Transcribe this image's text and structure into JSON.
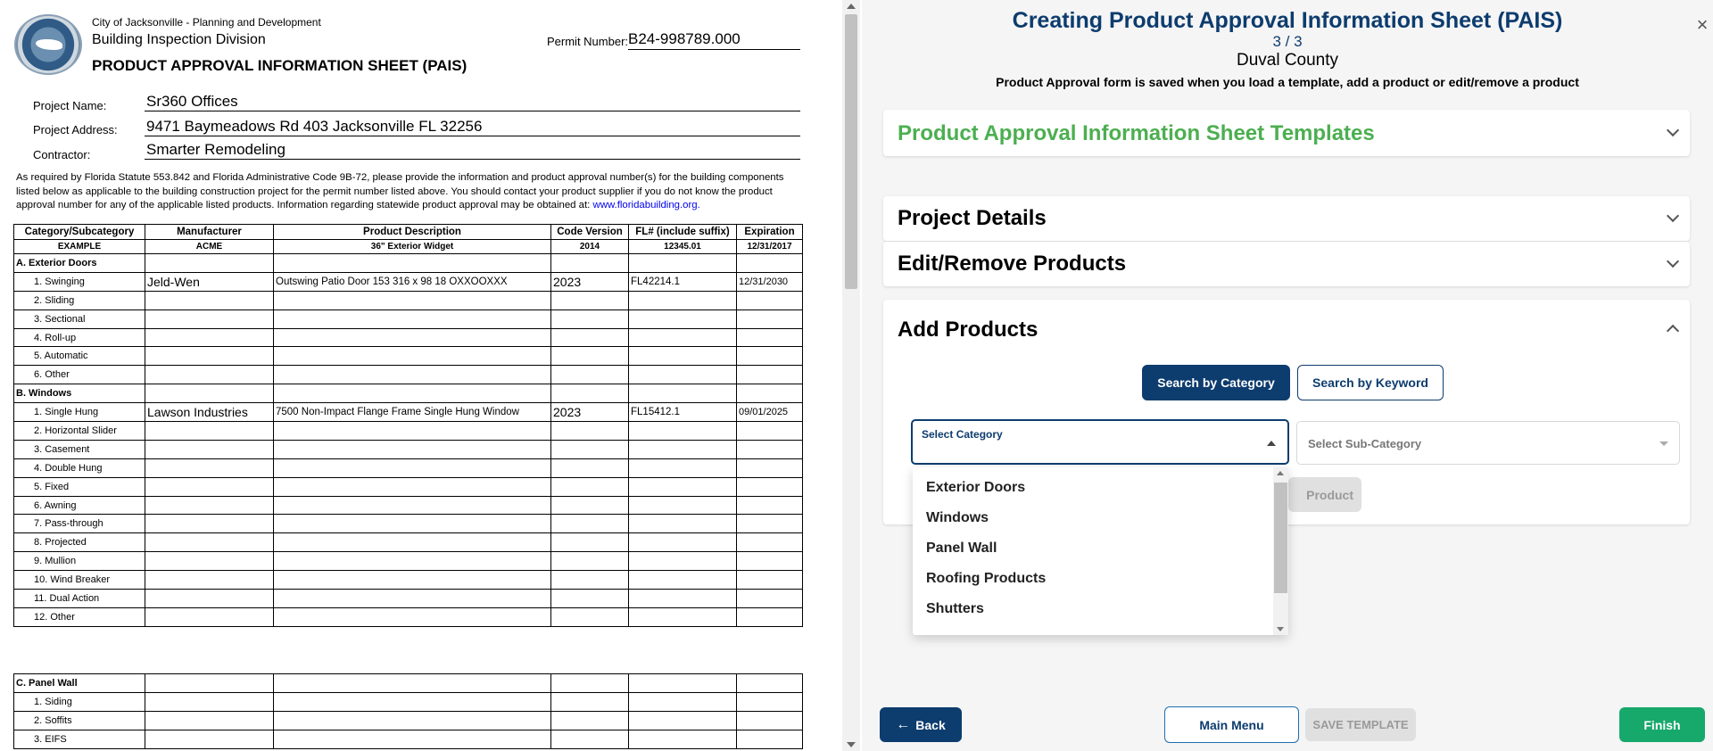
{
  "doc": {
    "header": {
      "city": "City of Jacksonville - Planning and Development",
      "division": "Building Inspection Division",
      "title": "PRODUCT APPROVAL INFORMATION SHEET (PAIS)",
      "permit_label": "Permit Number:",
      "permit_value": "B24-998789.000"
    },
    "project": {
      "name_label": "Project Name:",
      "name_value": "Sr360 Offices",
      "address_label": "Project Address:",
      "address_value": "9471 Baymeadows Rd 403 Jacksonville FL 32256",
      "contractor_label": "Contractor:",
      "contractor_value": "Smarter Remodeling"
    },
    "notice": {
      "text": "As required by Florida Statute 553.842 and Florida Administrative Code 9B-72, please provide the information and product approval number(s) for the building components listed below as applicable to the building construction project for the permit number listed above. You should contact your product supplier if you do not know the product approval number for any of the applicable listed products. Information regarding statewide product approval may be obtained at:",
      "link": "www.floridabuilding.org."
    },
    "table": {
      "headers": [
        "Category/Subcategory",
        "Manufacturer",
        "Product Description",
        "Code Version",
        "FL# (include suffix)",
        "Expiration"
      ],
      "example": [
        "EXAMPLE",
        "ACME",
        "36\" Exterior Widget",
        "2014",
        "12345.01",
        "12/31/2017"
      ],
      "section_a": "A. Exterior Doors",
      "a_rows": [
        [
          "1. Swinging",
          "Jeld-Wen",
          "Outswing Patio Door 153 316 x 98 18 OXXOOXXX",
          "2023",
          "FL42214.1",
          "12/31/2030"
        ],
        [
          "2. Sliding",
          "",
          "",
          "",
          "",
          ""
        ],
        [
          "3. Sectional",
          "",
          "",
          "",
          "",
          ""
        ],
        [
          "4. Roll-up",
          "",
          "",
          "",
          "",
          ""
        ],
        [
          "5. Automatic",
          "",
          "",
          "",
          "",
          ""
        ],
        [
          "6. Other",
          "",
          "",
          "",
          "",
          ""
        ]
      ],
      "section_b": "B. Windows",
      "b_rows": [
        [
          "1. Single Hung",
          "Lawson Industries",
          "7500 Non-Impact Flange Frame Single Hung Window",
          "2023",
          "FL15412.1",
          "09/01/2025"
        ],
        [
          "2. Horizontal Slider",
          "",
          "",
          "",
          "",
          ""
        ],
        [
          "3. Casement",
          "",
          "",
          "",
          "",
          ""
        ],
        [
          "4. Double Hung",
          "",
          "",
          "",
          "",
          ""
        ],
        [
          "5. Fixed",
          "",
          "",
          "",
          "",
          ""
        ],
        [
          "6. Awning",
          "",
          "",
          "",
          "",
          ""
        ],
        [
          "7. Pass-through",
          "",
          "",
          "",
          "",
          ""
        ],
        [
          "8. Projected",
          "",
          "",
          "",
          "",
          ""
        ],
        [
          "9. Mullion",
          "",
          "",
          "",
          "",
          ""
        ],
        [
          "10. Wind Breaker",
          "",
          "",
          "",
          "",
          ""
        ],
        [
          "11. Dual Action",
          "",
          "",
          "",
          "",
          ""
        ],
        [
          "12. Other",
          "",
          "",
          "",
          "",
          ""
        ]
      ],
      "section_c": "C. Panel Wall",
      "c_rows": [
        [
          "1. Siding",
          "",
          "",
          "",
          "",
          ""
        ],
        [
          "2. Soffits",
          "",
          "",
          "",
          "",
          ""
        ],
        [
          "3. EIFS",
          "",
          "",
          "",
          "",
          ""
        ]
      ]
    }
  },
  "panel": {
    "title": "Creating Product Approval Information Sheet (PAIS)",
    "step": "3 / 3",
    "county": "Duval County",
    "note": "Product Approval form is saved when you load a template, add a product or edit/remove a product",
    "close_icon": "×",
    "sections": {
      "templates": "Product Approval Information Sheet Templates",
      "project_details": "Project Details",
      "edit_remove": "Edit/Remove Products",
      "add_products": "Add Products"
    },
    "tabs": {
      "by_category": "Search by Category",
      "by_keyword": "Search by Keyword"
    },
    "category_select": {
      "label": "Select Category"
    },
    "subcategory_select": {
      "placeholder": "Select Sub-Category"
    },
    "add_product_button": "Product",
    "category_options": [
      "Exterior Doors",
      "Windows",
      "Panel Wall",
      "Roofing Products",
      "Shutters"
    ],
    "footer": {
      "back": "Back",
      "back_icon": "←",
      "main_menu": "Main Menu",
      "save_template": "SAVE TEMPLATE",
      "finish": "Finish"
    },
    "colors": {
      "primary": "#0d3c6e",
      "template_heading": "#4caf50",
      "finish": "#17a86b"
    }
  }
}
